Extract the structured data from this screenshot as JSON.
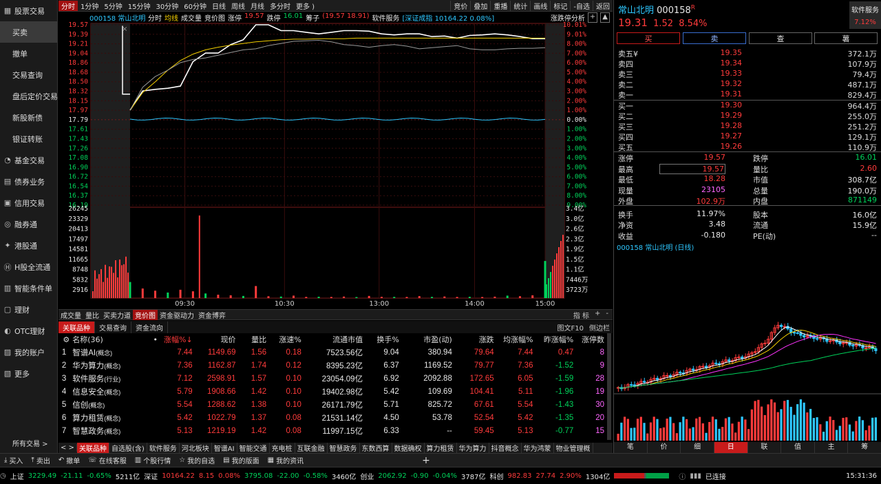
{
  "nav": {
    "items": [
      {
        "label": "股票交易",
        "icon": "chart-icon",
        "level": 0
      },
      {
        "label": "买卖",
        "level": 1,
        "active": true
      },
      {
        "label": "撤单",
        "level": 1
      },
      {
        "label": "交易查询",
        "level": 1
      },
      {
        "label": "盘后定价交易",
        "level": 1
      },
      {
        "label": "新股新债",
        "level": 1
      },
      {
        "label": "银证转账",
        "level": 1
      },
      {
        "label": "基金交易",
        "icon": "fund-icon",
        "level": 0
      },
      {
        "label": "债券业务",
        "icon": "bond-icon",
        "level": 0
      },
      {
        "label": "信用交易",
        "icon": "credit-icon",
        "level": 0
      },
      {
        "label": "融券通",
        "icon": "lend-icon",
        "level": 0
      },
      {
        "label": "港股通",
        "icon": "hk-icon",
        "level": 0
      },
      {
        "label": "H股全流通",
        "icon": "h-share-icon",
        "level": 0
      },
      {
        "label": "智能条件单",
        "icon": "smart-order-icon",
        "level": 0
      },
      {
        "label": "理财",
        "icon": "wealth-icon",
        "level": 0
      },
      {
        "label": "OTC理财",
        "icon": "otc-icon",
        "level": 0
      },
      {
        "label": "我的账户",
        "icon": "account-icon",
        "level": 0
      },
      {
        "label": "更多",
        "icon": "more-icon",
        "level": 0
      }
    ],
    "all_trades": "所有交易 >"
  },
  "topbar": {
    "periods": [
      "分时",
      "1分钟",
      "5分钟",
      "15分钟",
      "30分钟",
      "60分钟",
      "日线",
      "周线",
      "月线",
      "多分时",
      "更多 )"
    ],
    "right_buttons": [
      "竞价",
      "叠加",
      "重播",
      "统计",
      "画线",
      "标记",
      "-自选",
      "返回"
    ]
  },
  "chartinfo": {
    "code_name": "000158 常山北明",
    "items": [
      {
        "t": "分时",
        "c": "white"
      },
      {
        "t": "均线",
        "c": "yellow"
      },
      {
        "t": "成交量",
        "c": "white"
      },
      {
        "t": "竞价图",
        "c": "white"
      },
      {
        "t": "涨停",
        "c": "white"
      },
      {
        "t": "19.57",
        "c": "red"
      },
      {
        "t": "跌停",
        "c": "white"
      },
      {
        "t": "16.01",
        "c": "green"
      },
      {
        "t": "筹子",
        "c": "white"
      },
      {
        "t": "(19.57 18.91)",
        "c": "red"
      },
      {
        "t": "软件服务",
        "c": "white"
      },
      {
        "t": "[深证成指 10164.22 0.08%]",
        "c": "cyan"
      }
    ],
    "analysis_btn": "涨跌停分析"
  },
  "chart_data": [
    {
      "type": "line",
      "title": "000158 常山北明 分时",
      "price_ticks": [
        "19.57",
        "19.39",
        "19.21",
        "19.04",
        "18.86",
        "18.68",
        "18.50",
        "18.32",
        "18.15",
        "17.97",
        "17.79",
        "17.61",
        "17.43",
        "17.26",
        "17.08",
        "16.90",
        "16.72",
        "16.54",
        "16.37",
        "16.19"
      ],
      "pct_ticks": [
        "10.01%",
        "9.01%",
        "8.00%",
        "7.00%",
        "6.00%",
        "5.00%",
        "4.00%",
        "3.00%",
        "2.00%",
        "1.00%",
        "0.00%",
        "1.00%",
        "2.00%",
        "3.00%",
        "4.00%",
        "5.00%",
        "6.00%",
        "7.00%",
        "8.00%",
        "9.00%"
      ],
      "vol_ticks": [
        "26245",
        "23329",
        "20413",
        "17497",
        "14581",
        "11665",
        "8748",
        "5832",
        "2916"
      ],
      "amount_ticks": [
        "3.4亿",
        "3.0亿",
        "2.6亿",
        "2.3亿",
        "1.9亿",
        "1.5亿",
        "1.1亿",
        "7446万",
        "3723万"
      ],
      "x_ticks": [
        "09:30",
        "10:30",
        "13:00",
        "14:00",
        "15:00"
      ],
      "ylim": [
        16.19,
        19.57
      ],
      "prev_close": 17.79,
      "series": [
        {
          "name": "分时",
          "color": "#ffffff",
          "values": [
            17.97,
            18.33,
            18.36,
            18.38,
            18.42,
            18.88,
            19.04,
            19.04,
            19.2,
            19.29,
            19.57,
            19.57,
            19.46,
            19.46,
            19.43,
            19.4,
            19.43,
            19.46,
            19.46,
            19.45,
            19.4,
            19.38,
            19.4,
            19.4,
            19.35,
            19.36,
            19.32,
            19.37,
            19.38,
            19.4,
            19.38,
            19.35,
            19.31,
            19.31
          ]
        },
        {
          "name": "均线",
          "color": "#f5d000",
          "values": [
            17.97,
            18.3,
            18.5,
            18.72,
            18.9,
            19.02,
            19.1,
            19.15,
            19.19,
            19.22,
            19.25,
            19.27,
            19.29,
            19.3,
            19.3,
            19.31,
            19.31,
            19.31,
            19.32,
            19.32,
            19.32,
            19.32,
            19.32,
            19.32,
            19.32,
            19.32,
            19.32,
            19.32,
            19.32,
            19.32,
            19.32,
            19.32,
            19.32,
            19.32
          ]
        },
        {
          "name": "指数",
          "color": "#999999",
          "values": [
            17.97,
            18.4,
            18.6,
            18.72,
            18.86,
            18.92,
            18.95,
            19.0,
            19.05,
            19.1,
            19.12,
            19.18,
            19.22,
            19.26,
            19.27,
            19.28,
            19.25,
            19.2,
            19.18,
            19.15,
            19.18,
            19.2,
            19.17,
            19.12,
            19.14,
            19.16,
            19.18,
            19.12,
            19.1,
            19.1,
            19.12,
            19.13,
            19.13,
            19.14
          ]
        }
      ],
      "volumes": [
        5200,
        3100,
        2400,
        1800,
        2700,
        2200,
        1500,
        1100,
        900,
        700,
        3900,
        600,
        500,
        800,
        400,
        450,
        380,
        500,
        350,
        700,
        420,
        400,
        380,
        650,
        400,
        520,
        380,
        430,
        360,
        470,
        800,
        620,
        900,
        12000
      ]
    }
  ],
  "lowertabs": {
    "items": [
      "成交量",
      "量比",
      "买卖力道",
      "竞价图",
      "资金驱动力",
      "资金博弈"
    ],
    "active": 3,
    "right": [
      "指 标",
      "+",
      "-"
    ]
  },
  "sectortabs": {
    "items": [
      "关联品种",
      "交易查询",
      "资金流向"
    ],
    "active": 0,
    "right": [
      "图文F10",
      "侧边栏"
    ]
  },
  "table": {
    "headers": [
      "",
      "名称(36)",
      "•",
      "涨幅%↓",
      "现价",
      "量比",
      "涨速%",
      "流通市值",
      "换手%",
      "市盈(动)",
      "涨跌",
      "均涨幅%",
      "昨涨幅%",
      "涨停数"
    ],
    "rows": [
      {
        "idx": "1",
        "name": "智谱AI",
        "tag": "(概念)",
        "pct": "7.44",
        "price": "1149.69",
        "lb": "1.56",
        "spd": "0.18",
        "mcap": "7523.56亿",
        "turn": "9.04",
        "pe": "380.94",
        "chg": "79.64",
        "avg": "7.44",
        "yday": "0.47",
        "lim": "8"
      },
      {
        "idx": "2",
        "name": "华为算力",
        "tag": "(概念)",
        "pct": "7.36",
        "price": "1162.87",
        "lb": "1.74",
        "spd": "0.12",
        "mcap": "8395.23亿",
        "turn": "6.37",
        "pe": "1169.52",
        "chg": "79.77",
        "avg": "7.36",
        "yday": "-1.52",
        "lim": "9"
      },
      {
        "idx": "3",
        "name": "软件服务",
        "tag": "(行业)",
        "pct": "7.12",
        "price": "2598.91",
        "lb": "1.57",
        "spd": "0.10",
        "mcap": "23054.09亿",
        "turn": "6.92",
        "pe": "2092.88",
        "chg": "172.65",
        "avg": "6.05",
        "yday": "-1.59",
        "lim": "28"
      },
      {
        "idx": "4",
        "name": "信息安全",
        "tag": "(概念)",
        "pct": "5.79",
        "price": "1908.66",
        "lb": "1.42",
        "spd": "0.10",
        "mcap": "19402.98亿",
        "turn": "5.42",
        "pe": "109.69",
        "chg": "104.41",
        "avg": "5.11",
        "yday": "-1.96",
        "lim": "19"
      },
      {
        "idx": "5",
        "name": "信创",
        "tag": "(概念)",
        "pct": "5.54",
        "price": "1288.62",
        "lb": "1.38",
        "spd": "0.10",
        "mcap": "26171.79亿",
        "turn": "5.71",
        "pe": "825.72",
        "chg": "67.61",
        "avg": "5.54",
        "yday": "-1.43",
        "lim": "30"
      },
      {
        "idx": "6",
        "name": "算力租赁",
        "tag": "(概念)",
        "pct": "5.42",
        "price": "1022.79",
        "lb": "1.37",
        "spd": "0.08",
        "mcap": "21531.14亿",
        "turn": "4.50",
        "pe": "53.78",
        "chg": "52.54",
        "avg": "5.42",
        "yday": "-1.35",
        "lim": "20"
      },
      {
        "idx": "7",
        "name": "智慧政务",
        "tag": "(概念)",
        "pct": "5.13",
        "price": "1219.19",
        "lb": "1.42",
        "spd": "0.08",
        "mcap": "11997.15亿",
        "turn": "6.33",
        "pe": "--",
        "chg": "59.45",
        "avg": "5.13",
        "yday": "-0.77",
        "lim": "15"
      }
    ]
  },
  "secstrip": {
    "items": [
      "< >",
      "关联品种",
      "自选股(含)",
      "软件服务",
      "河北板块",
      "智谱AI",
      "智能交通",
      "充电桩",
      "互联金融",
      "智慧政务",
      "东数西算",
      "数据确权",
      "算力租赁",
      "华为算力",
      "抖音概念",
      "华为鸿蒙",
      "物业管理概"
    ],
    "active": 1
  },
  "actbar": {
    "items": [
      {
        "icon": "buy-icon",
        "label": "买入"
      },
      {
        "icon": "sell-icon",
        "label": "卖出"
      },
      {
        "icon": "cancel-icon",
        "label": "撤单"
      },
      {
        "icon": "query-icon",
        "label": "在线客服"
      },
      {
        "icon": "stock-icon",
        "label": "个股行情"
      },
      {
        "icon": "star-icon",
        "label": "我的自选"
      },
      {
        "icon": "layout-icon",
        "label": "我的版面"
      },
      {
        "icon": "news-icon",
        "label": "我的资讯"
      }
    ],
    "add": "+"
  },
  "statusbar": {
    "sh_label": "上证",
    "sh_val": "3229.49",
    "sh_chg": "-21.11",
    "sh_pct": "-0.65%",
    "sh_amt": "5211亿",
    "sz_label": "深证",
    "sz_val": "10164.22",
    "sz_chg": "8.15",
    "sz_pct": "0.08%",
    "mask": "3795.08",
    "m_chg": "-22.00",
    "m_pct": "-0.58%",
    "m_amt": "3460亿",
    "cy_label": "创业",
    "cy_val": "2062.92",
    "cy_chg": "-0.90",
    "cy_pct": "-0.04%",
    "cy_amt": "3787亿",
    "kc_label": "科创",
    "kc_val": "982.83",
    "kc_chg": "27.74",
    "kc_pct": "2.90%",
    "kc_amt": "1304亿",
    "conn": "已连接",
    "time": "15:31:36"
  },
  "right": {
    "name": "常山北明",
    "code": "000158",
    "flag": "R",
    "price": "19.31",
    "chg": "1.52",
    "pct": "8.54%",
    "sector_btn": "软件服务",
    "sector_pct": "7.12%",
    "buttons": [
      "买",
      "卖",
      "查",
      "薯"
    ],
    "asks": [
      {
        "l": "卖五",
        "p": "19.35",
        "v": "372.1万"
      },
      {
        "l": "卖四",
        "p": "19.34",
        "v": "107.9万"
      },
      {
        "l": "卖三",
        "p": "19.33",
        "v": "79.4万"
      },
      {
        "l": "卖二",
        "p": "19.32",
        "v": "487.1万"
      },
      {
        "l": "卖一",
        "p": "19.31",
        "v": "829.4万"
      }
    ],
    "ask_marker": "¥",
    "bids": [
      {
        "l": "买一",
        "p": "19.30",
        "v": "964.4万"
      },
      {
        "l": "买二",
        "p": "19.29",
        "v": "255.0万"
      },
      {
        "l": "买三",
        "p": "19.28",
        "v": "251.2万"
      },
      {
        "l": "买四",
        "p": "19.27",
        "v": "129.1万"
      },
      {
        "l": "买五",
        "p": "19.26",
        "v": "110.9万"
      }
    ],
    "stats": [
      {
        "l": "涨停",
        "v": "19.57",
        "c": "red",
        "l2": "跌停",
        "v2": "16.01",
        "c2": "green"
      },
      {
        "l": "最高",
        "v": "19.57",
        "c": "red",
        "l2": "量比",
        "v2": "2.60",
        "c2": "red"
      },
      {
        "l": "最低",
        "v": "18.28",
        "c": "red",
        "l2": "市值",
        "v2": "308.7亿",
        "c2": "white"
      },
      {
        "l": "现量",
        "v": "23105",
        "c": "mag",
        "l2": "总量",
        "v2": "190.0万",
        "c2": "white"
      },
      {
        "l": "外盘",
        "v": "102.9万",
        "c": "red",
        "l2": "内盘",
        "v2": "871149",
        "c2": "green"
      },
      {
        "l": "换手",
        "v": "11.97%",
        "c": "white",
        "l2": "股本",
        "v2": "16.0亿",
        "c2": "white"
      },
      {
        "l": "净资",
        "v": "3.48",
        "c": "white",
        "l2": "流通",
        "v2": "15.9亿",
        "c2": "white"
      },
      {
        "l": "收益",
        "v": "-0.180",
        "c": "white",
        "l2": "PE(动)",
        "v2": "--",
        "c2": "white"
      }
    ],
    "kline_title": "000158 常山北明 (日线)",
    "kline_tabs": [
      "笔",
      "价",
      "细",
      "日",
      "联",
      "值",
      "主",
      "筹"
    ],
    "kline_active": 3
  }
}
